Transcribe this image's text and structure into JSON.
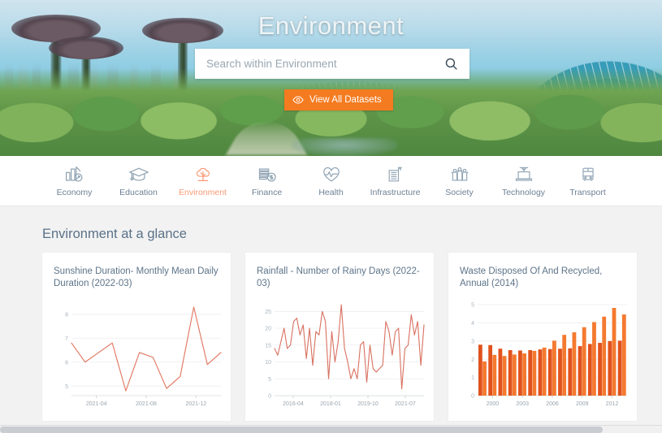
{
  "hero": {
    "title": "Environment",
    "search": {
      "placeholder": "Search within Environment",
      "value": "",
      "icon": "search-icon"
    },
    "view_all_button": {
      "label": "View All Datasets",
      "icon": "eye-icon",
      "color": "#f47b20"
    }
  },
  "categories": [
    {
      "label": "Economy",
      "icon": "bar-chart-arrow-icon",
      "active": false
    },
    {
      "label": "Education",
      "icon": "graduation-cap-icon",
      "active": false
    },
    {
      "label": "Environment",
      "icon": "tree-icon",
      "active": true
    },
    {
      "label": "Finance",
      "icon": "coins-dollar-icon",
      "active": false
    },
    {
      "label": "Health",
      "icon": "heart-pulse-icon",
      "active": false
    },
    {
      "label": "Infrastructure",
      "icon": "building-crane-icon",
      "active": false
    },
    {
      "label": "Society",
      "icon": "people-group-icon",
      "active": false
    },
    {
      "label": "Technology",
      "icon": "laptop-icon",
      "active": false
    },
    {
      "label": "Transport",
      "icon": "bus-icon",
      "active": false
    }
  ],
  "main": {
    "section_title": "Environment at a glance",
    "accent_color": "#f47b20",
    "title_color": "#5a7288",
    "page_background": "#f2f2f2"
  },
  "chart_data": [
    {
      "type": "line",
      "title": "Sunshine Duration- Monthly Mean Daily Duration (2022-03)",
      "xlabel": "",
      "ylabel": "",
      "ylim": [
        4.6,
        8.4
      ],
      "yticks": [
        5,
        6,
        7,
        8
      ],
      "grid": true,
      "legend": "none",
      "line_color": "#e0735c",
      "x": [
        "2021-03",
        "2021-04",
        "2021-05",
        "2021-06",
        "2021-07",
        "2021-08",
        "2021-09",
        "2021-10",
        "2021-11",
        "2021-12",
        "2022-01",
        "2022-02",
        "2022-03"
      ],
      "xtick_labels": [
        "2021-04",
        "2021-08",
        "2021-12"
      ],
      "values": [
        6.8,
        6.0,
        6.4,
        6.8,
        4.8,
        6.4,
        6.2,
        4.9,
        5.4,
        8.3,
        5.9,
        6.4
      ]
    },
    {
      "type": "line",
      "title": "Rainfall - Number of Rainy Days (2022-03)",
      "xlabel": "",
      "ylabel": "",
      "ylim": [
        0,
        27
      ],
      "yticks": [
        0,
        5,
        10,
        15,
        20,
        25
      ],
      "grid": true,
      "legend": "none",
      "line_color": "#d9705f",
      "xtick_labels": [
        "2016-04",
        "2018-01",
        "2019-10",
        "2021-07"
      ],
      "values": [
        14,
        12,
        16,
        20,
        14,
        15,
        22,
        23,
        18,
        21,
        11,
        20,
        9,
        19,
        18,
        25,
        22,
        5,
        19,
        10,
        16,
        27,
        14,
        10,
        5,
        8,
        5,
        15,
        16,
        4,
        15,
        8,
        7,
        8,
        9,
        22,
        19,
        12,
        19,
        20,
        2,
        14,
        15,
        24,
        18,
        22,
        9,
        21
      ]
    },
    {
      "type": "bar",
      "title": "Waste Disposed Of And Recycled, Annual (2014)",
      "xlabel": "",
      "ylabel": "",
      "ylim": [
        0,
        5
      ],
      "yticks": [
        0,
        1,
        2,
        3,
        4,
        5
      ],
      "grid": true,
      "legend": "none",
      "categories": [
        "2000",
        "2001",
        "2002",
        "2003",
        "2004",
        "2005",
        "2006",
        "2007",
        "2008",
        "2009",
        "2010",
        "2011",
        "2012",
        "2013",
        "2014"
      ],
      "xtick_labels": [
        "2000",
        "2003",
        "2006",
        "2009",
        "2012"
      ],
      "series": [
        {
          "name": "Waste Disposed Of",
          "color": "#e0521d",
          "values": [
            2.8,
            2.78,
            2.58,
            2.5,
            2.48,
            2.5,
            2.54,
            2.56,
            2.58,
            2.6,
            2.72,
            2.84,
            2.9,
            3.0,
            3.02
          ]
        },
        {
          "name": "Waste Recycled",
          "color": "#f4792f",
          "values": [
            1.88,
            2.24,
            2.18,
            2.26,
            2.32,
            2.46,
            2.64,
            3.02,
            3.34,
            3.48,
            3.76,
            4.04,
            4.34,
            4.82,
            4.46
          ]
        }
      ]
    }
  ]
}
